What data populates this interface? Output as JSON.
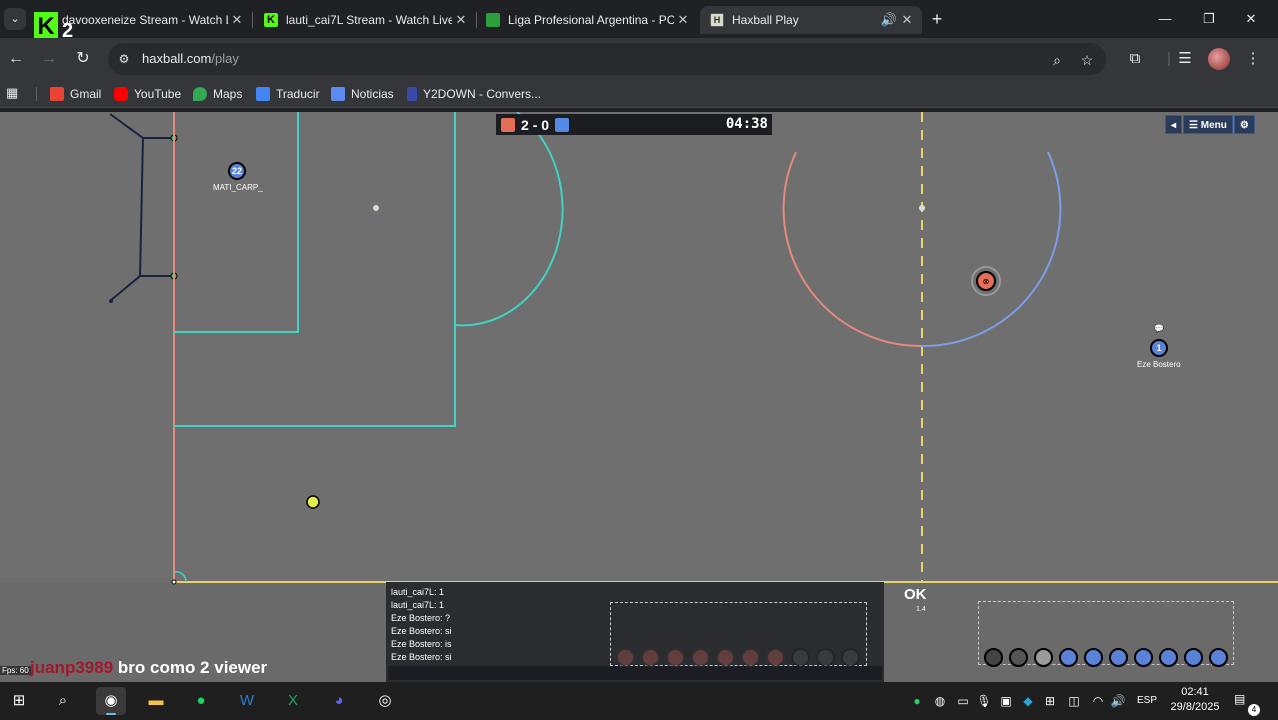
{
  "tabs": [
    {
      "title": "davooxeneize Stream - Watch L",
      "favicon": "kick-icon"
    },
    {
      "title": "lauti_cai7L Stream - Watch Live",
      "favicon": "kick-icon"
    },
    {
      "title": "Liga Profesional Argentina - PC",
      "favicon": "liga-icon"
    },
    {
      "title": "Haxball Play",
      "favicon": "haxball-icon",
      "active": true
    }
  ],
  "overlay_logo": {
    "letter": "K",
    "number": "2"
  },
  "address_bar": {
    "host": "haxball.com",
    "path": "/play"
  },
  "bookmarks": [
    {
      "label": "Gmail",
      "color": "#ea4335"
    },
    {
      "label": "YouTube",
      "color": "#ff0000"
    },
    {
      "label": "Maps",
      "color": "#34a853"
    },
    {
      "label": "Traducir",
      "color": "#4285f4"
    },
    {
      "label": "Noticias",
      "color": "#5b8def"
    },
    {
      "label": "Y2DOWN - Convers...",
      "color": "#3949ab"
    }
  ],
  "game": {
    "score_red": "2",
    "score_sep": "-",
    "score_blue": "0",
    "timer": "04:38",
    "red_color": "#e56e56",
    "blue_color": "#5689e5",
    "menu_buttons": [
      "◂",
      "☰ Menu",
      "⚙"
    ],
    "players": [
      {
        "number": "22",
        "name": "MATI_CARP_",
        "team": "blue"
      },
      {
        "number": "1",
        "name": "Eze Bostero",
        "team": "blue"
      }
    ]
  },
  "chat": {
    "lines": [
      "lauti_cai7L: 1",
      "lauti_cai7L: 1",
      "Eze Bostero: ?",
      "Eze Bostero: si",
      "Eze Bostero: is",
      "Eze Bostero: si"
    ]
  },
  "ok_indicator": {
    "label": "OK",
    "sub": "1.4"
  },
  "fps": "Fps: 60",
  "stream_chat": {
    "user": "juanp3989",
    "message": "bro como 2 viewer"
  },
  "taskbar": {
    "language": "ESP",
    "time": "02:41",
    "date": "29/8/2025",
    "notifications": "4"
  }
}
